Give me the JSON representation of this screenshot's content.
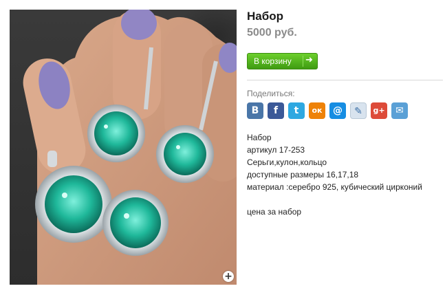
{
  "product": {
    "title": "Набор",
    "price": "5000 руб.",
    "cart_button_label": "В корзину",
    "share_label": "Поделиться:",
    "description_lines": [
      "Набор",
      "артикул 17-253",
      "Серьги,кулон,кольцо",
      "доступные размеры 16,17,18",
      "материал :серебро 925, кубический цирконий",
      "",
      "цена за набор"
    ]
  },
  "social": [
    {
      "name": "vkontakte-icon",
      "glyph": "B",
      "color": "#4a76a8"
    },
    {
      "name": "facebook-icon",
      "glyph": "f",
      "color": "#3b5998"
    },
    {
      "name": "twitter-icon",
      "glyph": "t",
      "color": "#2ea8e1"
    },
    {
      "name": "odnoklassniki-icon",
      "glyph": "ок",
      "color": "#ee8208"
    },
    {
      "name": "mailru-icon",
      "glyph": "@",
      "color": "#168de2"
    },
    {
      "name": "livejournal-icon",
      "glyph": "✎",
      "color": "#d8e3ee"
    },
    {
      "name": "googleplus-icon",
      "glyph": "g+",
      "color": "#dd4b39"
    },
    {
      "name": "email-icon",
      "glyph": "✉",
      "color": "#5aa0d6"
    }
  ],
  "icons": {
    "zoom": "zoom-plus-icon",
    "cart_arrow": "arrow-right-icon"
  },
  "colors": {
    "cart_button": "#4fb51b",
    "price": "#8a8a8a",
    "stone": "#1fb89a"
  }
}
